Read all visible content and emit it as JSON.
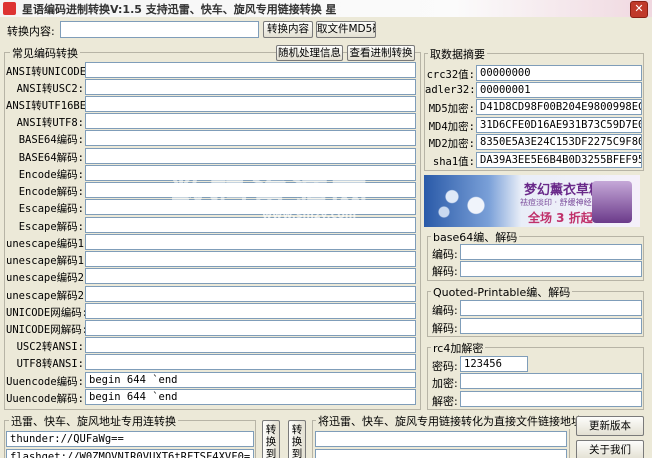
{
  "title": "星语编码进制转换V:1.5  支持迅雷、快车、旋风专用链接转换  星",
  "close_glyph": "✕",
  "top": {
    "label": "转换内容:",
    "input_value": "",
    "btn_convert": "转换内容",
    "btn_md5": "取文件MD5码"
  },
  "common": {
    "title": "常见编码转换",
    "btn_random": "随机处理信息",
    "btn_view": "查看进制转换",
    "rows": [
      {
        "label": "ANSI转UNICODE:",
        "value": ""
      },
      {
        "label": "ANSI转USC2:",
        "value": ""
      },
      {
        "label": "ANSI转UTF16BE:",
        "value": ""
      },
      {
        "label": "ANSI转UTF8:",
        "value": ""
      },
      {
        "label": "BASE64编码:",
        "value": ""
      },
      {
        "label": "BASE64解码:",
        "value": ""
      },
      {
        "label": "Encode编码:",
        "value": ""
      },
      {
        "label": "Encode解码:",
        "value": ""
      },
      {
        "label": "Escape编码:",
        "value": ""
      },
      {
        "label": "Escape解码:",
        "value": ""
      },
      {
        "label": "unescape编码1:",
        "value": ""
      },
      {
        "label": "unescape解码1:",
        "value": ""
      },
      {
        "label": "unescape编码2:",
        "value": ""
      },
      {
        "label": "unescape解码2:",
        "value": ""
      },
      {
        "label": "UNICODE网编码:",
        "value": ""
      },
      {
        "label": "UNICODE网解码:",
        "value": ""
      },
      {
        "label": "USC2转ANSI:",
        "value": ""
      },
      {
        "label": "UTF8转ANSI:",
        "value": ""
      },
      {
        "label": "Uuencode编码:",
        "value": "begin 644  `end"
      },
      {
        "label": "Uuencode解码:",
        "value": "begin 644  `end"
      }
    ]
  },
  "digest": {
    "title": "取数据摘要",
    "rows": [
      {
        "label": "crc32值:",
        "value": "00000000"
      },
      {
        "label": "adler32:",
        "value": "00000001"
      },
      {
        "label": "MD5加密:",
        "value": "D41D8CD98F00B204E9800998ECF8427E"
      },
      {
        "label": "MD4加密:",
        "value": "31D6CFE0D16AE931B73C59D7E0C089C0"
      },
      {
        "label": "MD2加密:",
        "value": "8350E5A3E24C153DF2275C9F80692773"
      },
      {
        "label": "sha1值:",
        "value": "DA39A3EE5E6B4B0D3255BFEF95601890A"
      }
    ]
  },
  "ad": {
    "title": "梦幻薰衣草精油",
    "subtitle": "祛痘淡印 · 舒缓神经 · 安眠助眠",
    "promo": "全场 3 折起"
  },
  "watermark": {
    "main": "数码资源网",
    "sub": "www.smzy.com"
  },
  "base64": {
    "title": "base64编、解码",
    "rows": [
      {
        "label": "编码:",
        "value": ""
      },
      {
        "label": "解码:",
        "value": ""
      }
    ]
  },
  "qp": {
    "title": "Quoted-Printable编、解码",
    "rows": [
      {
        "label": "编码:",
        "value": ""
      },
      {
        "label": "解码:",
        "value": ""
      }
    ]
  },
  "rc4": {
    "title": "rc4加解密",
    "rows": [
      {
        "label": "密码:",
        "value": "123456"
      },
      {
        "label": "加密:",
        "value": ""
      },
      {
        "label": "解密:",
        "value": ""
      }
    ]
  },
  "thunder": {
    "title": "迅雷、快车、旋风地址专用连转换",
    "thunder_value": "thunder://QUFaWg==",
    "flashget_value": "flashget://W0ZMQVNIR0VUXT6tRFTSF4XVF0=",
    "btn1": "转换到专用",
    "btn2": "转换到普通"
  },
  "direct": {
    "title": "将迅雷、快车、旋风专用链接转化为直接文件链接地址",
    "value1": "",
    "value2": ""
  },
  "side": {
    "btn_update": "更新版本",
    "btn_about": "关于我们"
  }
}
